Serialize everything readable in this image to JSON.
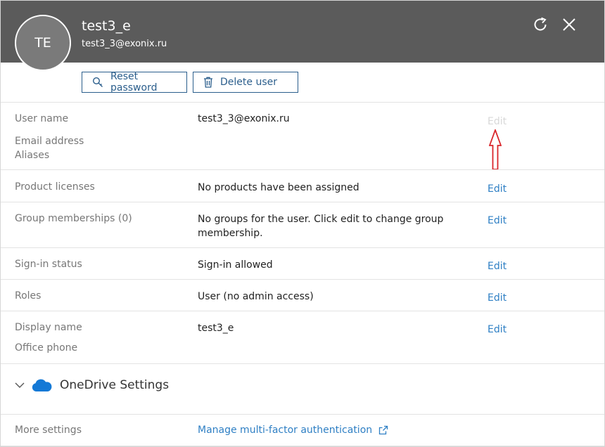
{
  "header": {
    "initials": "TE",
    "user_name": "test3_e",
    "user_email": "test3_3@exonix.ru",
    "refresh_icon": "refresh-icon",
    "close_icon": "close-icon"
  },
  "actions": {
    "reset_password": "Reset password",
    "delete_user": "Delete user"
  },
  "fields": {
    "user_name_label": "User name",
    "email_label": "Email address",
    "aliases_label": "Aliases",
    "user_name_value": "test3_3@exonix.ru",
    "product_licenses_label": "Product licenses",
    "product_licenses_value": "No products have been assigned",
    "group_label": "Group memberships (0)",
    "group_value": "No groups for the user. Click edit to change group membership.",
    "signin_label": "Sign-in status",
    "signin_value": "Sign-in allowed",
    "roles_label": "Roles",
    "roles_value": "User (no admin access)",
    "display_name_label": "Display name",
    "office_phone_label": "Office phone",
    "display_name_value": "test3_e",
    "edit_label": "Edit"
  },
  "onedrive": {
    "title": "OneDrive Settings"
  },
  "more_settings": {
    "label": "More settings",
    "link": "Manage multi-factor authentication"
  },
  "colors": {
    "header_bg": "#5b5b5b",
    "accent": "#2e7fc4",
    "annotation_arrow": "#d9262b"
  }
}
